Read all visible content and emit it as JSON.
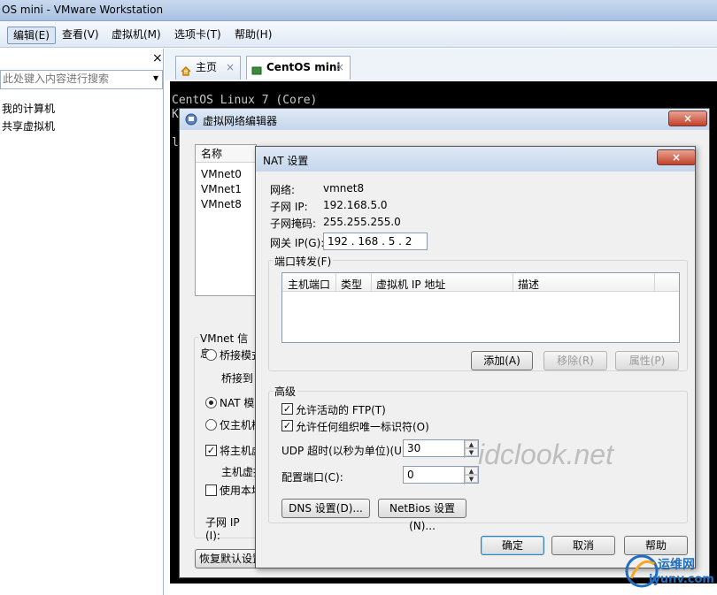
{
  "window": {
    "title": "OS mini - VMware Workstation"
  },
  "menubar": {
    "items": [
      "编辑(E)",
      "查看(V)",
      "虚拟机(M)",
      "选项卡(T)",
      "帮助(H)"
    ]
  },
  "left_panel": {
    "close": "×",
    "search_placeholder": "此处键入内容进行搜索",
    "dropdown": "▾",
    "items": [
      "我的计算机",
      "共享虚拟机"
    ]
  },
  "tabs": [
    {
      "label": "主页",
      "close": "×"
    },
    {
      "label": "CentOS mini",
      "close": "×"
    }
  ],
  "terminal": {
    "lines": [
      "CentOS Linux 7 (Core)",
      "K",
      "l"
    ]
  },
  "vne": {
    "title": "虚拟网络编辑器",
    "close": "×",
    "columns": [
      "名称"
    ],
    "rows": [
      "VMnet0",
      "VMnet1",
      "VMnet8"
    ],
    "info_legend": "VMnet 信息",
    "bridge": "桥接模式",
    "bridge_to": "桥接到",
    "nat": "NAT 模式",
    "host_only": "仅主机模式",
    "connect_host": "将主机虚",
    "host_virtual": "主机虚拟",
    "use_local": "使用本地",
    "subnet_ip": "子网 IP (I):",
    "restore": "恢复默认设置"
  },
  "nat": {
    "title": "NAT 设置",
    "close": "×",
    "network_label": "网络:",
    "network_value": "vmnet8",
    "subnet_ip_label": "子网 IP:",
    "subnet_ip_value": "192.168.5.0",
    "subnet_mask_label": "子网掩码:",
    "subnet_mask_value": "255.255.255.0",
    "gateway_label": "网关 IP(G):",
    "gateway_value": "192 . 168 .  5  .  2",
    "port_forward_legend": "端口转发(F)",
    "pf_columns": [
      "主机端口",
      "类型",
      "虚拟机 IP 地址",
      "描述"
    ],
    "add_btn": "添加(A)",
    "remove_btn": "移除(R)",
    "props_btn": "属性(P)",
    "advanced_legend": "高级",
    "allow_ftp": "允许活动的 FTP(T)",
    "allow_oui": "允许任何组织唯一标识符(O)",
    "udp_label": "UDP 超时(以秒为单位)(U):",
    "udp_value": "30",
    "config_port_label": "配置端口(C):",
    "config_port_value": "0",
    "dns_btn": "DNS 设置(D)...",
    "netbios_btn": "NetBios 设置(N)...",
    "ok_btn": "确定",
    "cancel_btn": "取消",
    "help_btn": "帮助"
  },
  "watermark": {
    "text": "idclook.net",
    "logo_line1": "运维网",
    "logo_line2": "iyunv.com"
  }
}
